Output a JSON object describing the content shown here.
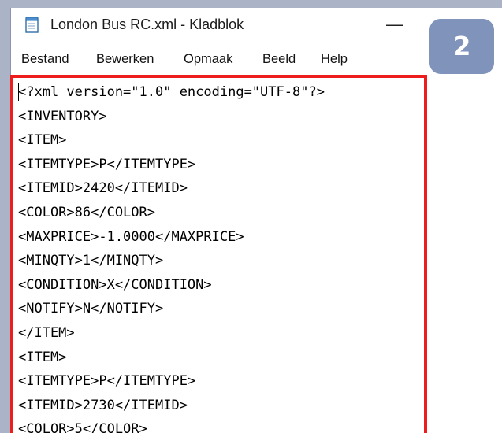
{
  "window": {
    "title": "London Bus RC.xml - Kladblok",
    "minimize_glyph": "—",
    "icon": "notepad-icon"
  },
  "menu": [
    {
      "label": "Bestand"
    },
    {
      "label": "Bewerken"
    },
    {
      "label": "Opmaak"
    },
    {
      "label": "Beeld"
    },
    {
      "label": "Help"
    }
  ],
  "badge": {
    "number": "2",
    "color": "#7f93bb"
  },
  "highlight_color": "#ee1d1d",
  "editor": {
    "lines": [
      "<?xml version=\"1.0\" encoding=\"UTF-8\"?>",
      "<INVENTORY>",
      "<ITEM>",
      "<ITEMTYPE>P</ITEMTYPE>",
      "<ITEMID>2420</ITEMID>",
      "<COLOR>86</COLOR>",
      "<MAXPRICE>-1.0000</MAXPRICE>",
      "<MINQTY>1</MINQTY>",
      "<CONDITION>X</CONDITION>",
      "<NOTIFY>N</NOTIFY>",
      "</ITEM>",
      "<ITEM>",
      "<ITEMTYPE>P</ITEMTYPE>",
      "<ITEMID>2730</ITEMID>",
      "<COLOR>5</COLOR>"
    ]
  }
}
